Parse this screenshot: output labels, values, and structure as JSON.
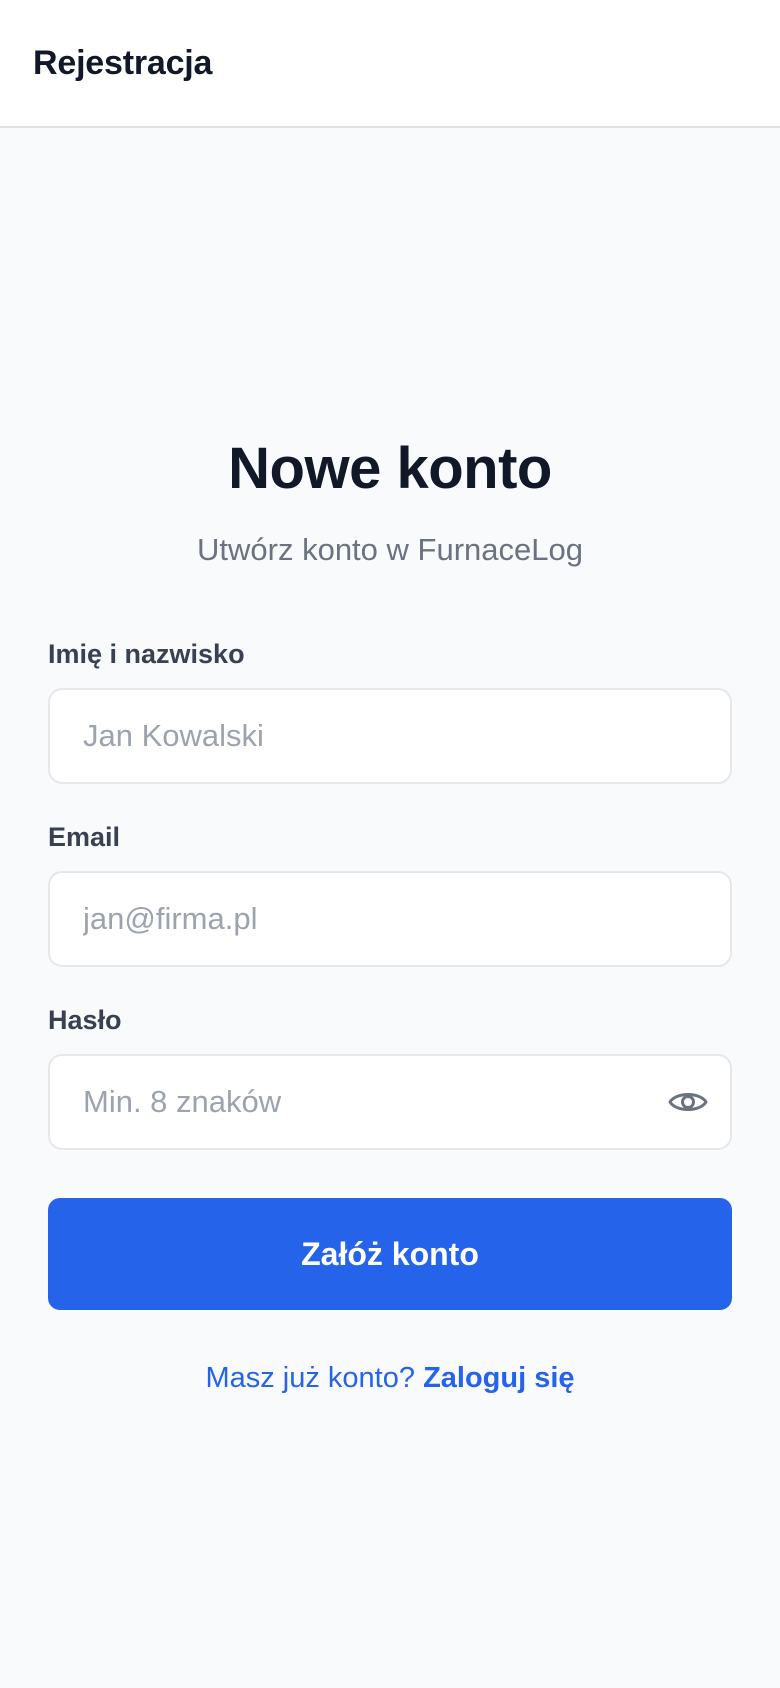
{
  "header": {
    "title": "Rejestracja"
  },
  "form": {
    "heading": "Nowe konto",
    "subheading": "Utwórz konto w FurnaceLog",
    "name_field": {
      "label": "Imię i nazwisko",
      "placeholder": "Jan Kowalski",
      "value": ""
    },
    "email_field": {
      "label": "Email",
      "placeholder": "jan@firma.pl",
      "value": ""
    },
    "password_field": {
      "label": "Hasło",
      "placeholder": "Min. 8 znaków",
      "value": "",
      "toggle_icon": "eye-icon"
    },
    "submit_label": "Załóż konto",
    "login_prompt": "Masz już konto?",
    "login_link": "Zaloguj się"
  },
  "colors": {
    "accent": "#2563eb",
    "background": "#f8fafc",
    "header_bg": "#ffffff",
    "heading_text": "#111827",
    "muted_text": "#6b7280",
    "placeholder_text": "#9ca3af",
    "input_border": "#e5e7eb"
  }
}
